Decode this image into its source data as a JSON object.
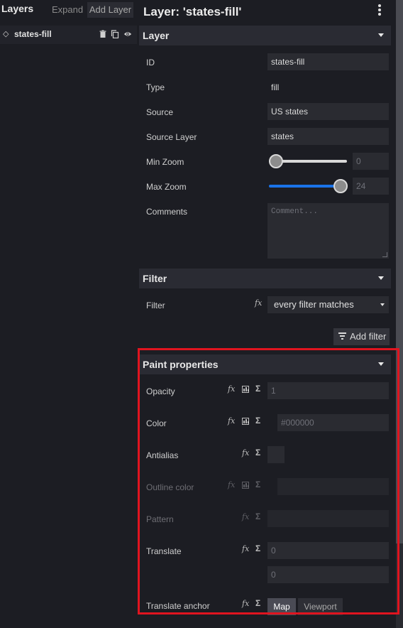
{
  "left": {
    "title": "Layers",
    "expand_label": "Expand",
    "add_layer_label": "Add Layer",
    "layers": [
      {
        "name": "states-fill"
      }
    ]
  },
  "panel": {
    "title": "Layer: 'states-fill'"
  },
  "layer_section": {
    "title": "Layer",
    "id_label": "ID",
    "id_value": "states-fill",
    "type_label": "Type",
    "type_value": "fill",
    "source_label": "Source",
    "source_value": "US states",
    "source_layer_label": "Source Layer",
    "source_layer_value": "states",
    "min_zoom_label": "Min Zoom",
    "min_zoom_value": "0",
    "min_zoom_level": 0,
    "max_zoom_label": "Max Zoom",
    "max_zoom_value": "24",
    "max_zoom_level": 24,
    "comments_label": "Comments",
    "comments_placeholder": "Comment..."
  },
  "filter_section": {
    "title": "Filter",
    "filter_label": "Filter",
    "filter_value": "every filter matches",
    "add_filter_label": "Add filter"
  },
  "paint_section": {
    "title": "Paint properties",
    "opacity_label": "Opacity",
    "opacity_placeholder": "1",
    "color_label": "Color",
    "color_placeholder": "#000000",
    "antialias_label": "Antialias",
    "outline_color_label": "Outline color",
    "pattern_label": "Pattern",
    "translate_label": "Translate",
    "translate_x_placeholder": "0",
    "translate_y_placeholder": "0",
    "translate_anchor_label": "Translate anchor",
    "anchor_map_label": "Map",
    "anchor_viewport_label": "Viewport"
  },
  "icons": {
    "fx": "fx",
    "sigma": "Σ"
  },
  "colors": {
    "accent": "#1a73e8",
    "highlight": "#e0141f"
  }
}
